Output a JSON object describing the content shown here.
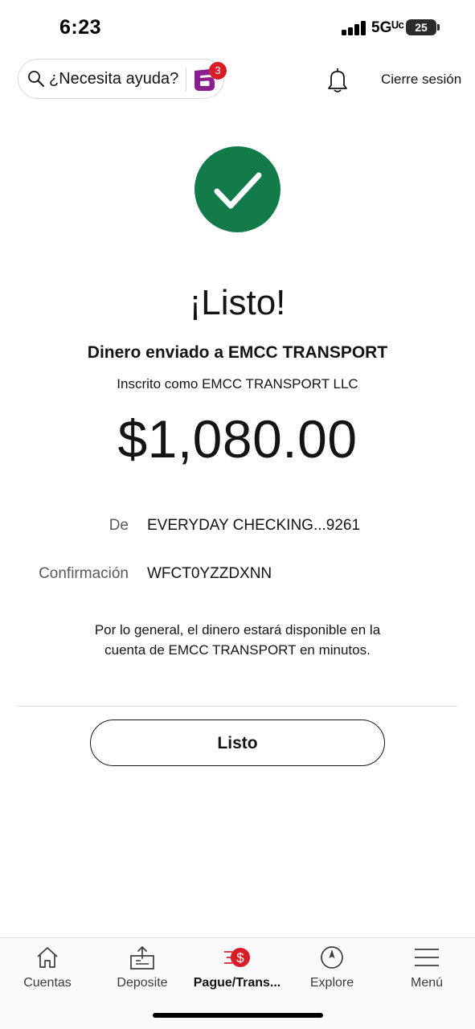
{
  "status_bar": {
    "time": "6:23",
    "network": "5Gᵁᶜ",
    "battery": "25"
  },
  "header": {
    "help_placeholder": "¿Necesita ayuda?",
    "assistant_badge_count": "3",
    "logout_label": "Cierre sesión",
    "icons": [
      "search-icon",
      "assistant-logo-icon",
      "bell-icon"
    ]
  },
  "confirmation": {
    "headline": "¡Listo!",
    "recipient_line": "Dinero enviado a EMCC TRANSPORT",
    "enrolled_line": "Inscrito como EMCC TRANSPORT LLC",
    "amount": "$1,080.00",
    "details": [
      {
        "label": "De",
        "value": "EVERYDAY CHECKING...9261"
      },
      {
        "label": "Confirmación",
        "value": "WFCT0YZZDXNN"
      }
    ],
    "availability_note": "Por lo general, el dinero estará disponible en la cuenta de EMCC TRANSPORT en minutos.",
    "done_button": "Listo"
  },
  "tab_bar": {
    "tabs": [
      {
        "label": "Cuentas",
        "icon": "home-icon",
        "active": false
      },
      {
        "label": "Deposite",
        "icon": "deposit-icon",
        "active": false
      },
      {
        "label": "Pague/Trans...",
        "icon": "pay-transfer-icon",
        "active": true
      },
      {
        "label": "Explore",
        "icon": "compass-icon",
        "active": false
      },
      {
        "label": "Menú",
        "icon": "menu-icon",
        "active": false
      }
    ]
  },
  "colors": {
    "success_green": "#137a4a",
    "brand_red": "#d71e28",
    "text": "#141414",
    "muted_text": "#5a5a5a"
  }
}
